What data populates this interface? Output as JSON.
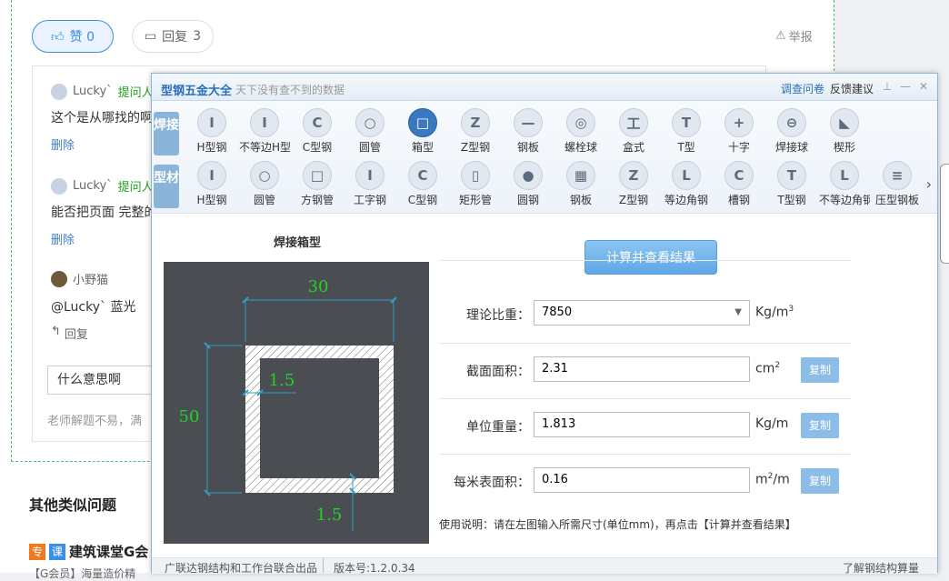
{
  "qa": {
    "like_label": "赞 0",
    "reply_label": "回复",
    "reply_count": "3",
    "report_label": "举报",
    "comments": [
      {
        "user": "Lucky`",
        "role": "提问人",
        "text": "这个是从哪找的啊",
        "action": "删除"
      },
      {
        "user": "Lucky`",
        "role": "提问人",
        "text": "能否把页面 完整的",
        "action": "删除"
      },
      {
        "user": "小野猫",
        "role": "",
        "text": "@Lucky` 蓝光",
        "action": "回复"
      }
    ],
    "input_value": "什么意思啊",
    "hint": "老师解题不易，满",
    "other_title": "其他类似问题",
    "other_item": "建筑课堂G会",
    "other_sub": "【G会员】海量造价精",
    "badge1": "专",
    "badge2": "课"
  },
  "app": {
    "title": "型钢五金大全",
    "subtitle": "天下没有查不到的数据",
    "link_survey": "调查问卷",
    "link_feedback": "反馈建议",
    "cat_weld": "焊接",
    "cat_profile": "型材",
    "weld_items": [
      "H型钢",
      "不等边H型",
      "C型钢",
      "圆管",
      "箱型",
      "Z型钢",
      "钢板",
      "螺栓球",
      "盒式",
      "T型",
      "十字",
      "焊接球",
      "楔形"
    ],
    "weld_icons": [
      "I",
      "I",
      "C",
      "○",
      "□",
      "Z",
      "—",
      "◎",
      "工",
      "T",
      "+",
      "⊖",
      "◣"
    ],
    "profile_items": [
      "H型钢",
      "圆管",
      "方钢管",
      "工字钢",
      "C型钢",
      "矩形管",
      "圆钢",
      "钢板",
      "Z型钢",
      "等边角钢",
      "槽钢",
      "T型钢",
      "不等边角钢",
      "压型钢板"
    ],
    "profile_icons": [
      "I",
      "○",
      "□",
      "I",
      "C",
      "▯",
      "●",
      "▦",
      "Z",
      "L",
      "C",
      "T",
      "L",
      "≡"
    ],
    "selected": "箱型",
    "drawing_title": "焊接箱型",
    "dim_width": "30",
    "dim_height": "50",
    "dim_t1": "1.5",
    "dim_t2": "1.5",
    "calc_label": "计算并查看结果",
    "rows": [
      {
        "label": "理论比重：",
        "value": "7850",
        "unit": "Kg/m",
        "sup": "3",
        "copy": ""
      },
      {
        "label": "截面面积：",
        "value": "2.31",
        "unit": "cm",
        "sup": "2",
        "copy": "复制"
      },
      {
        "label": "单位重量：",
        "value": "1.813",
        "unit": "Kg/m",
        "sup": "",
        "copy": "复制"
      },
      {
        "label": "每米表面积：",
        "value": "0.16",
        "unit": "m",
        "sup": "2",
        "unit_tail": "/m",
        "copy": "复制"
      }
    ],
    "note": "使用说明：请在左图输入所需尺寸(单位mm)，再点击【计算并查看结果】",
    "footer_left": "广联达钢结构和工作台联合出品",
    "footer_version": "版本号:1.2.0.34",
    "footer_right": "了解钢结构算量"
  }
}
